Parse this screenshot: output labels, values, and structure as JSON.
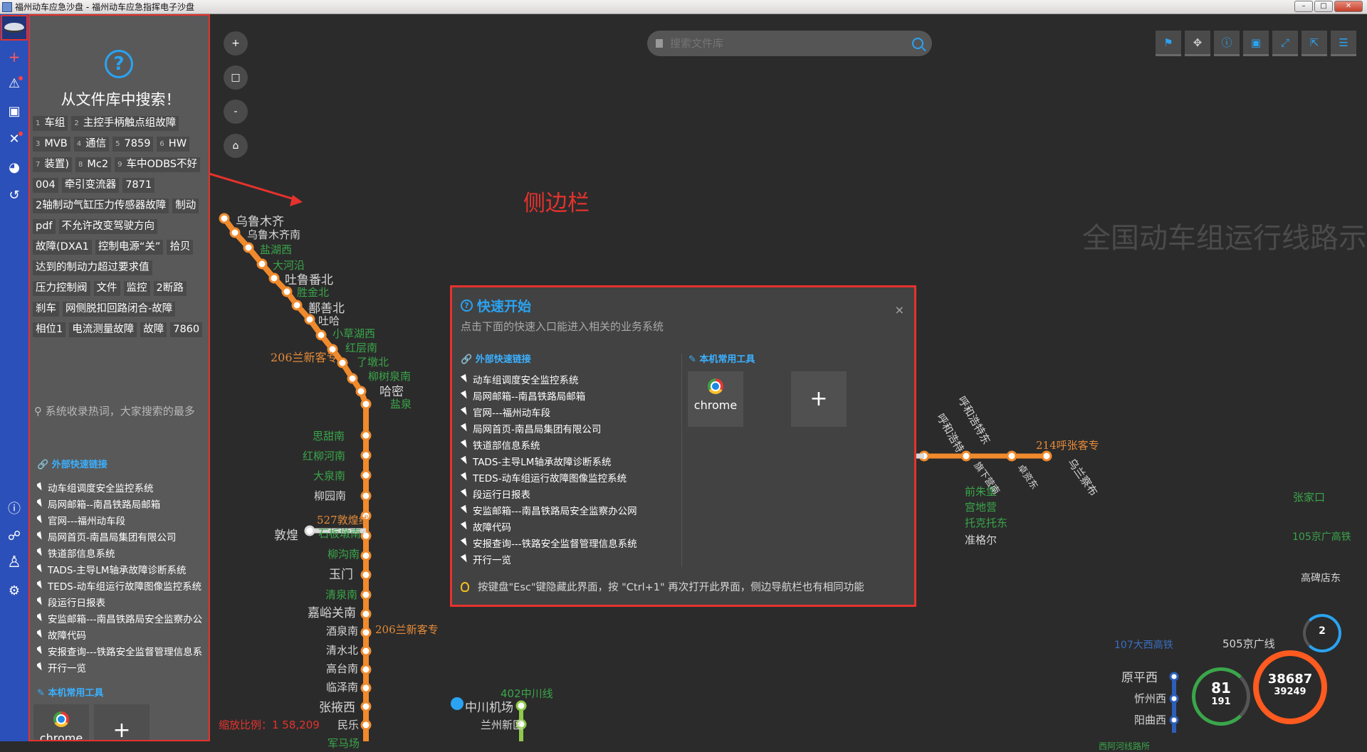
{
  "window": {
    "title": "福州动车应急沙盘 - 福州动车应急指挥电子沙盘",
    "controls": [
      "–",
      "□",
      "✕"
    ]
  },
  "sidebar": {
    "title": "从文件库中搜索！",
    "tags": [
      {
        "n": "1",
        "label": "车组"
      },
      {
        "n": "2",
        "label": "主控手柄触点组故障"
      },
      {
        "n": "3",
        "label": "MVB"
      },
      {
        "n": "4",
        "label": "通信"
      },
      {
        "n": "5",
        "label": "7859"
      },
      {
        "n": "6",
        "label": "HW"
      },
      {
        "n": "7",
        "label": "装置)"
      },
      {
        "n": "8",
        "label": "Mc2"
      },
      {
        "n": "9",
        "label": "车中ODBS不好"
      },
      {
        "n": "",
        "label": "004"
      },
      {
        "n": "",
        "label": "牵引变流器"
      },
      {
        "n": "",
        "label": "7871"
      },
      {
        "n": "",
        "label": "2轴制动气缸压力传感器故障"
      },
      {
        "n": "",
        "label": "制动"
      },
      {
        "n": "",
        "label": "pdf"
      },
      {
        "n": "",
        "label": "不允许改变驾驶方向"
      },
      {
        "n": "",
        "label": "故障(DXA1"
      },
      {
        "n": "",
        "label": "控制电源“关”"
      },
      {
        "n": "",
        "label": "拾贝"
      },
      {
        "n": "",
        "label": "达到的制动力超过要求值"
      },
      {
        "n": "",
        "label": "压力控制阀"
      },
      {
        "n": "",
        "label": "文件"
      },
      {
        "n": "",
        "label": "监控"
      },
      {
        "n": "",
        "label": "2断路"
      },
      {
        "n": "",
        "label": "刹车"
      },
      {
        "n": "",
        "label": "网侧脱扣回路闭合-故障"
      },
      {
        "n": "",
        "label": "相位1"
      },
      {
        "n": "",
        "label": "电流测量故障"
      },
      {
        "n": "",
        "label": "故障"
      },
      {
        "n": "",
        "label": "7860"
      }
    ],
    "hint": "系统收录热词，大家搜索的最多",
    "links_title": "外部快速链接",
    "links": [
      "动车组调度安全监控系统",
      "局网邮箱--南昌铁路局邮箱",
      "官网---福州动车段",
      "局网首页-南昌局集团有限公司",
      "铁道部信息系统",
      "TADS-主导LM轴承故障诊断系统",
      "TEDS-动车组运行故障图像监控系统",
      "段运行日报表",
      "安监邮箱---南昌铁路局安全监察办公",
      "故障代码",
      "安报查询---铁路安全监督管理信息系",
      "开行一览"
    ],
    "tools_title": "本机常用工具",
    "tool_chrome": "chrome",
    "tool_add": "+"
  },
  "map": {
    "search_placeholder": "搜索文件库",
    "zoom_in": "+",
    "zoom_box": "□",
    "zoom_out": "-",
    "home": "⌂",
    "watermark": "全国动车组运行线路示",
    "annotation": "侧边栏",
    "scale": "缩放比例：1 58,209",
    "labels": {
      "wlmq": "乌鲁木齐",
      "wlmqn": "乌鲁木齐南",
      "yhx": "盐湖西",
      "dhy": "大河沿",
      "tlfb": "吐鲁番北",
      "sjb": "胜金北",
      "sssb": "鄯善北",
      "th": "吐哈",
      "xchx": "小草湖西",
      "hcn": "红层南",
      "ldb": "了墩北",
      "lsqn": "柳树泉南",
      "hm": "哈密",
      "yq": "盐泉",
      "line206a": "206兰新客专",
      "sth": "思甜南",
      "hlh": "红柳河南",
      "dqn": "大泉南",
      "lyn": "柳园南",
      "line527": "527敦煌线",
      "dh": "敦煌",
      "sbqn": "石板墩南",
      "lgn": "柳沟南",
      "ym": "玉门",
      "qqn": "清泉南",
      "jygn": "嘉峪关南",
      "jqn": "酒泉南",
      "qsb": "清水北",
      "gtn": "高台南",
      "lzn": "临泽南",
      "zyx": "张掖西",
      "ml": "民乐",
      "jmc": "军马场",
      "line206b": "206兰新客专",
      "line402": "402中川线",
      "zcjc": "中川机场",
      "lzxq": "兰州新区",
      "line214": "214呼张客专",
      "hhhtd": "呼和浩特东",
      "hhht": "呼和浩特",
      "qzb": "前朱堡",
      "gdy": "宫地营",
      "tkt": "托克托东",
      "zge": "准格尔",
      "wlcb": "乌兰察布",
      "zz": "卓资东",
      "qxy": "旗下营南",
      "line105": "105京广高铁",
      "gbd": "高碑店东",
      "ypx": "原平西",
      "xzx": "忻州西",
      "yqx": "阳曲西",
      "line505": "505京广线",
      "line107": "107大西高铁",
      "xnh": "西阿河线路所",
      "zjk": "张家口"
    }
  },
  "dashboard": {
    "g1_top": "81",
    "g1_bottom": "191",
    "g2_top": "38687",
    "g2_bottom": "39249",
    "g3": "2"
  },
  "modal": {
    "title": "快速开始",
    "subtitle": "点击下面的快速入口能进入相关的业务系统",
    "close": "×",
    "links_title": "外部快速链接",
    "tools_title": "本机常用工具",
    "links": [
      "动车组调度安全监控系统",
      "局网邮箱--南昌铁路局邮箱",
      "官网---福州动车段",
      "局网首页-南昌局集团有限公司",
      "铁道部信息系统",
      "TADS-主导LM轴承故障诊断系统",
      "TEDS-动车组运行故障图像监控系统",
      "段运行日报表",
      "安监邮箱---南昌铁路局安全监察办公网",
      "故障代码",
      "安报查询---铁路安全监督管理信息系统",
      "开行一览"
    ],
    "tool_chrome": "chrome",
    "tool_add": "+",
    "footer": "按键盘\"Esc\"键隐藏此界面，按 \"Ctrl+1\" 再次打开此界面，侧边导航栏也有相同功能"
  },
  "colors": {
    "accent": "#2aa3f2",
    "annotation": "#e5322d",
    "rail": "#2c50b9",
    "line_orange": "#f08a2c",
    "line_gray": "#d9d9d9"
  }
}
